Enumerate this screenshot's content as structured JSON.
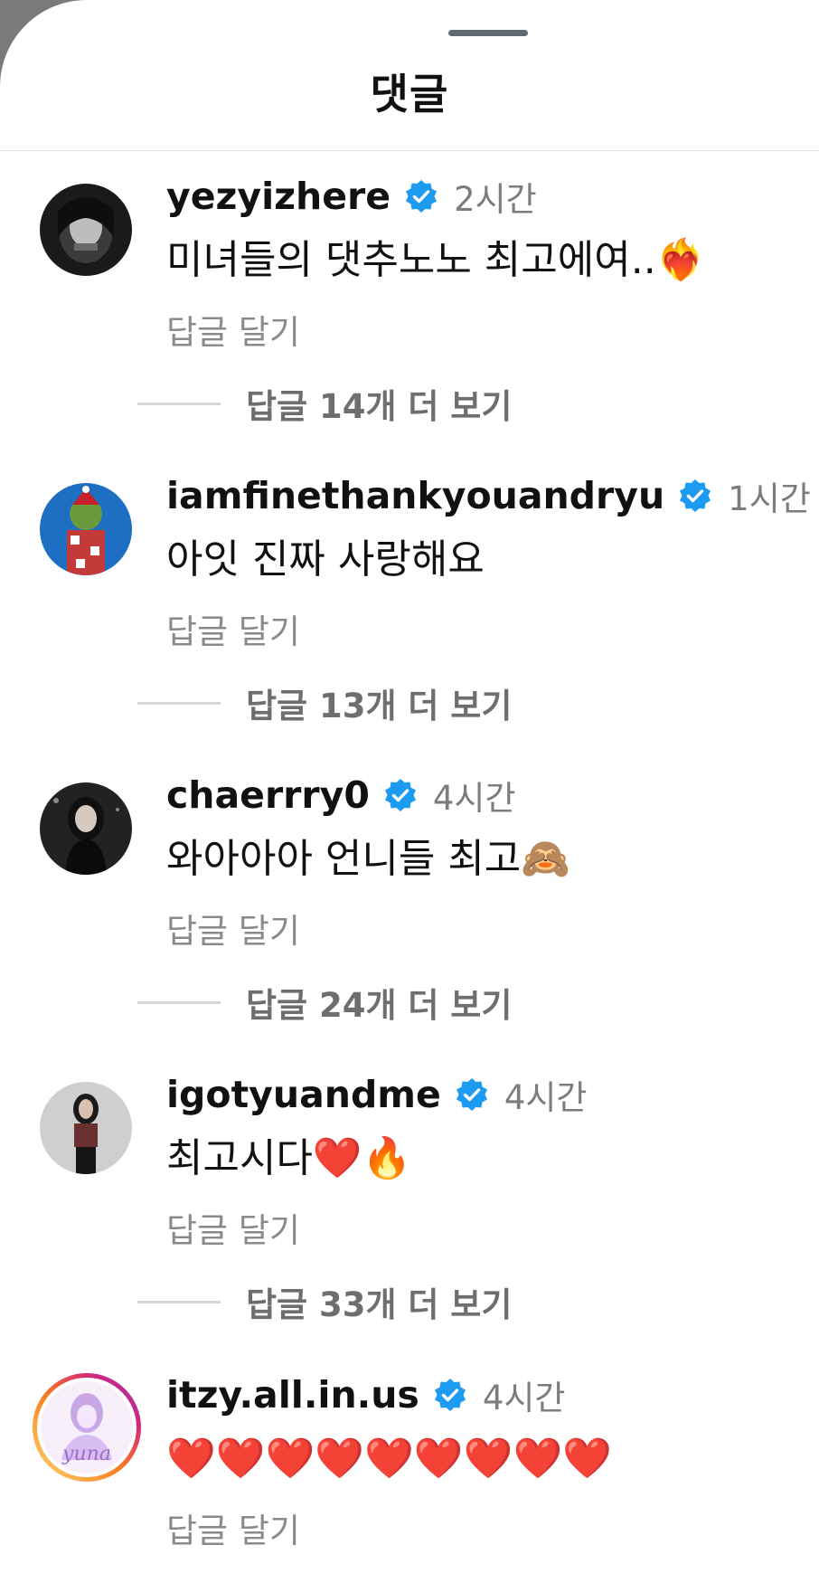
{
  "sheet": {
    "title": "댓글"
  },
  "comments": [
    {
      "username": "yezyizhere",
      "time": "2시간",
      "text": "미녀들의 댓추노노 최고에여..❤️‍🔥",
      "reply": "답글 달기",
      "more_replies": "답글 14개 더 보기"
    },
    {
      "username": "iamfinethankyouandryu",
      "time": "1시간",
      "text": "아잇 진짜 사랑해요",
      "reply": "답글 달기",
      "more_replies": "답글 13개 더 보기"
    },
    {
      "username": "chaerrry0",
      "time": "4시간",
      "text": "와아아아 언니들 최고🙈",
      "reply": "답글 달기",
      "more_replies": "답글 24개 더 보기"
    },
    {
      "username": "igotyuandme",
      "time": "4시간",
      "text": "최고시다❤️🔥",
      "reply": "답글 달기",
      "more_replies": "답글 33개 더 보기"
    },
    {
      "username": "itzy.all.in.us",
      "time": "4시간",
      "text": "❤️❤️❤️❤️❤️❤️❤️❤️❤️",
      "reply": "답글 달기",
      "avatar_text": "yuna"
    }
  ],
  "icons": {
    "verified": "verified-badge-icon"
  },
  "colors": {
    "verified": "#1d9bf0",
    "muted": "#8a8a8a",
    "heart": "#ff2a55"
  }
}
